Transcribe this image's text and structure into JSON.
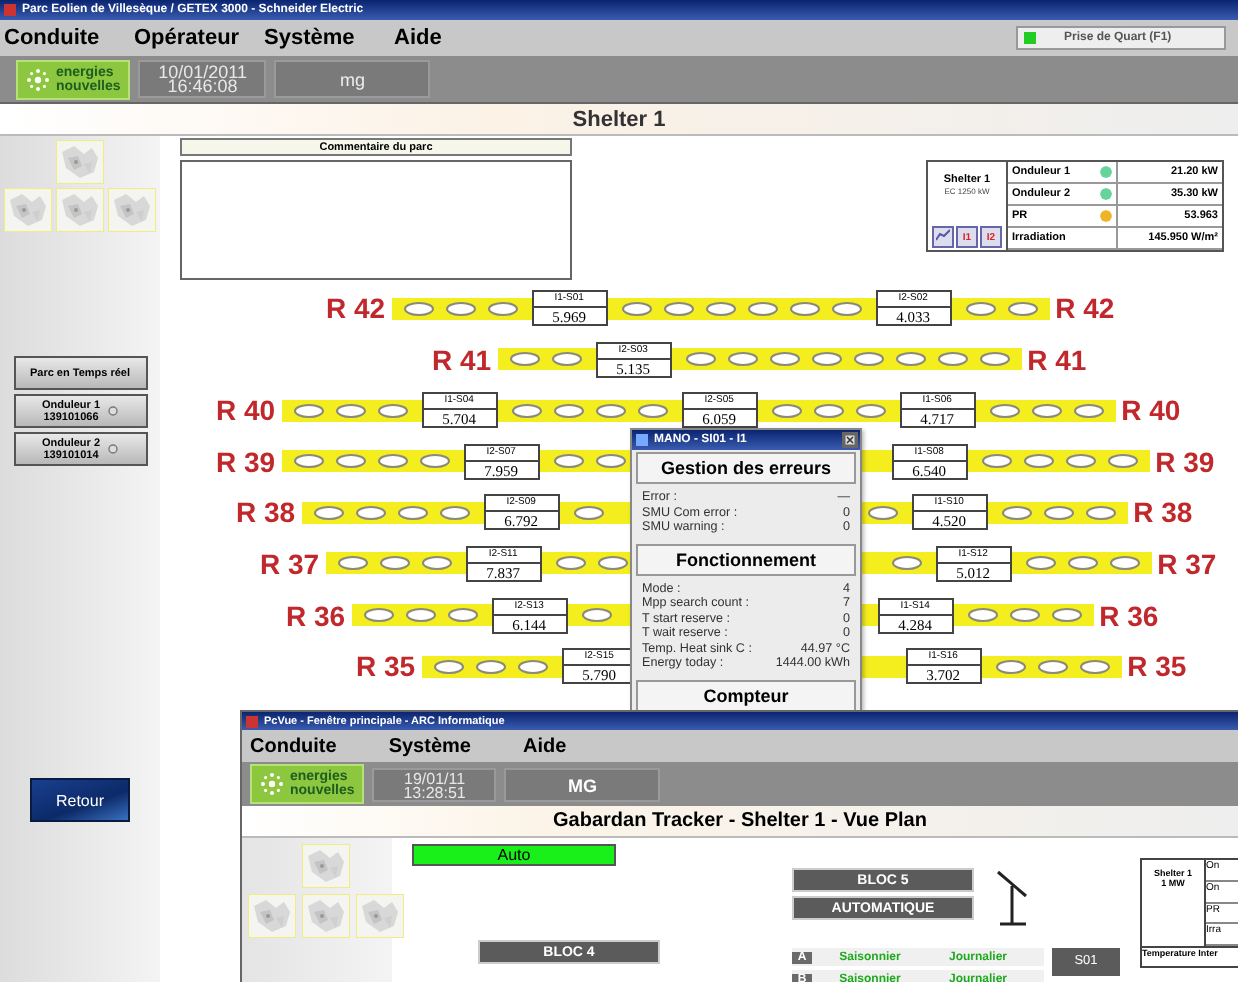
{
  "window": {
    "title": "Parc Eolien de Villesèque / GETEX 3000 - Schneider Electric"
  },
  "menu": [
    {
      "label": "Conduite"
    },
    {
      "label": "Opérateur"
    },
    {
      "label": "Système"
    },
    {
      "label": "Aide"
    }
  ],
  "shift_button": {
    "label": "Prise de Quart (F1)",
    "on": true
  },
  "toolbar": {
    "logo_line1": "energies",
    "logo_line2": "nouvelles",
    "date": "10/01/2011",
    "time": "16:46:08",
    "user": "mg"
  },
  "header": "Shelter 1",
  "sidebar": {
    "buttons": [
      {
        "label": "Parc en Temps réel"
      },
      {
        "label": "Onduleur 1",
        "code": "139101066"
      },
      {
        "label": "Onduleur 2",
        "code": "139101014"
      }
    ],
    "back_button": "Retour"
  },
  "comment": {
    "title": "Commentaire du parc"
  },
  "summary": {
    "title": "Shelter 1",
    "subtitle": "EC 1250 kW",
    "buttons": [
      "I1",
      "I2"
    ],
    "rows": [
      {
        "name": "Onduleur 1",
        "color": "#66d39a",
        "value": "21.20 kW"
      },
      {
        "name": "Onduleur 2",
        "color": "#66d39a",
        "value": "35.30 kW"
      },
      {
        "name": "PR",
        "color": "#f0b429",
        "value": "53.963"
      },
      {
        "name": "Irradiation",
        "value": "145.950 W/m²"
      }
    ]
  },
  "rows": [
    {
      "label": "R 42",
      "label_right": "R 42",
      "inverters": [
        {
          "name": "I1-S01",
          "value": "5.969"
        },
        {
          "name": "I2-S02",
          "value": "4.033"
        }
      ]
    },
    {
      "label": "R 41",
      "label_right": "R 41",
      "inverters": [
        {
          "name": "I2-S03",
          "value": "5.135"
        }
      ]
    },
    {
      "label": "R 40",
      "label_right": "R 40",
      "inverters": [
        {
          "name": "I1-S04",
          "value": "5.704"
        },
        {
          "name": "I2-S05",
          "value": "6.059"
        },
        {
          "name": "I1-S06",
          "value": "4.717"
        }
      ]
    },
    {
      "label": "R 39",
      "label_right": "R 39",
      "inverters": [
        {
          "name": "I2-S07",
          "value": "7.959"
        },
        {
          "name": "I1-S08",
          "value": "6.540"
        }
      ]
    },
    {
      "label": "R 38",
      "label_right": "R 38",
      "inverters": [
        {
          "name": "I2-S09",
          "value": "6.792"
        },
        {
          "name": "I1-S10",
          "value": "4.520"
        }
      ]
    },
    {
      "label": "R 37",
      "label_right": "R 37",
      "inverters": [
        {
          "name": "I2-S11",
          "value": "7.837"
        },
        {
          "name": "I1-S12",
          "value": "5.012"
        }
      ]
    },
    {
      "label": "R 36",
      "label_right": "R 36",
      "inverters": [
        {
          "name": "I2-S13",
          "value": "6.144"
        },
        {
          "name": "I1-S14",
          "value": "4.284"
        }
      ]
    },
    {
      "label": "R 35",
      "label_right": "R 35",
      "inverters": [
        {
          "name": "I2-S15",
          "value": "5.790"
        },
        {
          "name": "I1-S16",
          "value": "3.702"
        }
      ]
    }
  ],
  "popup": {
    "title": "MANO - SI01 - I1",
    "sections": [
      {
        "title": "Gestion des erreurs",
        "items": [
          {
            "label": "Error :",
            "value": "—"
          },
          {
            "label": "SMU Com error :",
            "value": "0"
          },
          {
            "label": "SMU warning :",
            "value": "0"
          }
        ]
      },
      {
        "title": "Fonctionnement",
        "items": [
          {
            "label": "Mode :",
            "value": "4"
          },
          {
            "label": "Mpp search count :",
            "value": "7"
          },
          {
            "label": "T start reserve :",
            "value": "0"
          },
          {
            "label": "T wait reserve :",
            "value": "0"
          },
          {
            "label": "Temp. Heat sink C :",
            "value": "44.97 °C"
          },
          {
            "label": "Energy today :",
            "value": "1444.00 kWh"
          }
        ]
      },
      {
        "title": "Compteur"
      }
    ]
  },
  "second_window": {
    "title": "PcVue - Fenêtre principale - ARC Informatique",
    "menu": [
      {
        "label": "Conduite"
      },
      {
        "label": "Système"
      },
      {
        "label": "Aide"
      }
    ],
    "date": "19/01/11",
    "time": "13:28:51",
    "user": "MG",
    "logo_line1": "energies",
    "logo_line2": "nouvelles",
    "header": "Gabardan Tracker - Shelter 1 - Vue Plan",
    "mode": "Auto",
    "bloc5": "BLOC 5",
    "bloc5_state": "AUTOMATIQUE",
    "bloc4": "BLOC 4",
    "trackers": [
      {
        "letter": "A",
        "mode_1": "Saisonnier",
        "mode_2": "Journalier"
      },
      {
        "letter": "B",
        "mode_1": "Saisonnier",
        "mode_2": "Journalier"
      }
    ],
    "station": "S01",
    "summary": {
      "title": "Shelter 1",
      "subtitle": "1 MW",
      "rows": [
        "On",
        "On",
        "PR",
        "Irra"
      ],
      "footer": "Temperature Inter"
    }
  }
}
